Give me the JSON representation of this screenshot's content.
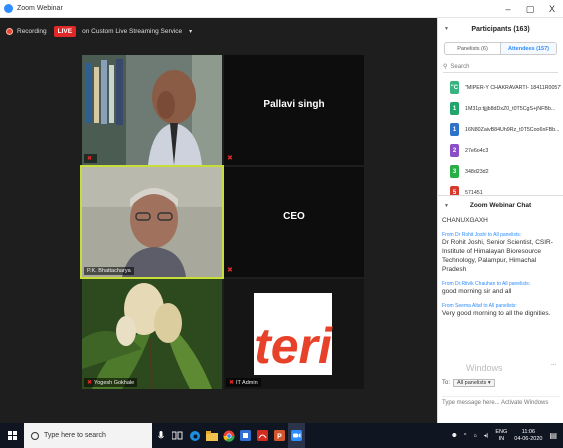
{
  "window": {
    "title": "Zoom Webinar",
    "minimize": "–",
    "restore": "▢",
    "close": "X"
  },
  "toolbar": {
    "recording": "Recording",
    "live": "LIVE",
    "stream": "on Custom Live Streaming Service",
    "caret": "▾"
  },
  "tiles": [
    {
      "name": "",
      "label": ""
    },
    {
      "name": "Pallavi singh",
      "label": ""
    },
    {
      "name": "",
      "label": "P.K. Bhattacharya"
    },
    {
      "name": "CEO",
      "label": ""
    },
    {
      "name": "",
      "label": "Yogesh Gokhale"
    },
    {
      "name": "",
      "label": "IT Admin"
    }
  ],
  "participants": {
    "title": "Participants (163)",
    "tabs": [
      "Panelists (6)",
      "Attendees (157)"
    ],
    "search": "Search",
    "list": [
      {
        "initial": "\"C",
        "color": "#36b37e",
        "name": "\"MIPER-Y CHAKRAVARTI- 18411R0057\""
      },
      {
        "initial": "1",
        "color": "#20a56b",
        "name": "1M31p:tjjjb8dDxZ0_t0T5CgS+jNFBb..."
      },
      {
        "initial": "1",
        "color": "#2d73c9",
        "name": "16N80ZaivB84Uh9Rz_t0T5Coo6nFBb..."
      },
      {
        "initial": "2",
        "color": "#8a4fc7",
        "name": "27e6o4c3"
      },
      {
        "initial": "3",
        "color": "#27ae45",
        "name": "348d23d2"
      },
      {
        "initial": "5",
        "color": "#d63a2f",
        "name": "571451"
      }
    ]
  },
  "chat": {
    "title": "Zoom Webinar Chat",
    "top": "CHANUXGAXH",
    "messages": [
      {
        "from": "From Dr Rohit Joshi to All panelists:",
        "text": "Dr Rohit Joshi, Senior Scientist, CSIR-Institute of Himalayan Bioresource Technology, Palampur, Himachal Pradesh"
      },
      {
        "from": "From Dr.Ritvik Chauhan to All panelists:",
        "text": "good morning sir and all"
      },
      {
        "from": "From Seema Altaf to All panelists:",
        "text": "Very good morning to all the dignities."
      }
    ],
    "to_label": "To:",
    "to_value": "All panelists ▾",
    "activate": "Windows",
    "more": "...",
    "input_placeholder": "Type message here...  Activate Windows"
  },
  "taskbar": {
    "search_placeholder": "Type here to search",
    "lang": "ENG",
    "region": "IN",
    "time": "11:06",
    "date": "04-06-2020"
  }
}
